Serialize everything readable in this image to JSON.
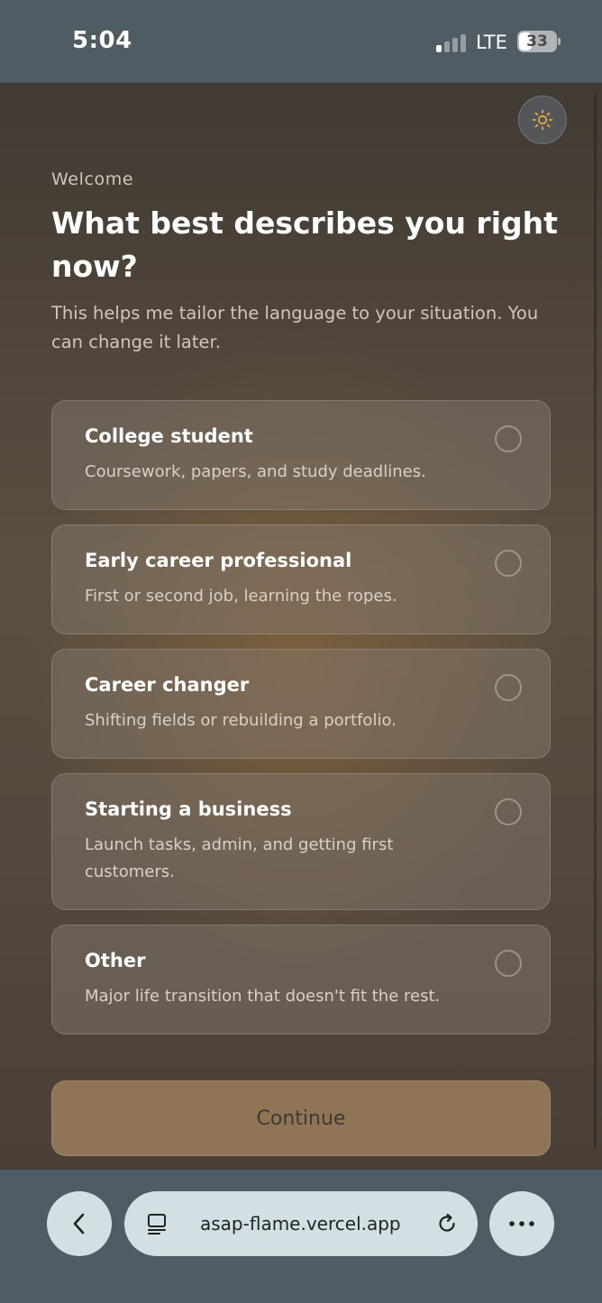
{
  "status_bar": {
    "time": "5:04",
    "network": "LTE",
    "battery": "33",
    "signal_bars_active": 1
  },
  "theme_toggle": {
    "icon": "sun-icon"
  },
  "header": {
    "eyebrow": "Welcome",
    "title": "What best describes you right now?",
    "subtitle": "This helps me tailor the language to your situation. You can change it later."
  },
  "options": [
    {
      "title": "College student",
      "description": "Coursework, papers, and study deadlines."
    },
    {
      "title": "Early career professional",
      "description": "First or second job, learning the ropes."
    },
    {
      "title": "Career changer",
      "description": "Shifting fields or rebuilding a portfolio."
    },
    {
      "title": "Starting a business",
      "description": "Launch tasks, admin, and getting first customers."
    },
    {
      "title": "Other",
      "description": "Major life transition that doesn't fit the rest."
    }
  ],
  "continue_button": {
    "label": "Continue"
  },
  "browser": {
    "url": "asap-flame.vercel.app",
    "back_icon": "chevron-left-icon",
    "tabs_icon": "page-icon",
    "reload_icon": "reload-icon",
    "more_icon": "more-icon"
  },
  "colors": {
    "accent_button": "#8f7556",
    "chrome": "#4f5c63",
    "browser_pill": "#d3dfe3",
    "sun_icon": "#e2a94a"
  }
}
